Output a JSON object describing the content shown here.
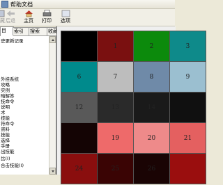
{
  "window": {
    "title": "帮助文档"
  },
  "toolbar": {
    "buttons": [
      {
        "label": "隐藏",
        "enabled": false,
        "icon": "hide-icon"
      },
      {
        "label": "后退",
        "enabled": false,
        "icon": "back-arrow-icon"
      },
      {
        "label": "主页",
        "enabled": true,
        "icon": "home-icon"
      },
      {
        "label": "打印",
        "enabled": true,
        "icon": "print-icon"
      },
      {
        "label": "选项",
        "enabled": true,
        "icon": "options-icon"
      }
    ]
  },
  "tabs": [
    "目",
    "索引",
    "搜索",
    "收藏夹"
  ],
  "tree": [
    "史更新记录",
    "",
    "",
    "",
    "",
    "",
    "",
    "外挂系统",
    "攻略",
    "实例",
    "暗解答",
    "技命令",
    "说明",
    "术",
    "技能",
    "符命令",
    "资料",
    "技能",
    "选择",
    "手册",
    "出技能",
    "比(I)",
    "合击技能(I)"
  ],
  "swatch_colors": [
    "#000000",
    "#7a1010",
    "#0c8a0c",
    "#0e8a8a",
    "#008a8c",
    "#bdbdbd",
    "#6f8aa8",
    "#9bbfd0",
    "#595959",
    "#2a2a2a",
    "#1a1a1a",
    "#101010",
    "#140404",
    "#ee6a6a",
    "#ee8a8a",
    "#e46060",
    "#8a0e0e",
    "#3a0404",
    "#1a0404",
    "#9a0e0e"
  ],
  "swatches": [
    {
      "label": ""
    },
    {
      "label": "1"
    },
    {
      "label": "2"
    },
    {
      "label": "3"
    },
    {
      "label": "6"
    },
    {
      "label": "7"
    },
    {
      "label": "8"
    },
    {
      "label": "9"
    },
    {
      "label": "12"
    },
    {
      "label": "13"
    },
    {
      "label": "14"
    },
    {
      "label": ""
    },
    {
      "label": ""
    },
    {
      "label": "19"
    },
    {
      "label": "20"
    },
    {
      "label": "21"
    },
    {
      "label": "24"
    },
    {
      "label": "25"
    },
    {
      "label": "26"
    },
    {
      "label": ""
    }
  ]
}
